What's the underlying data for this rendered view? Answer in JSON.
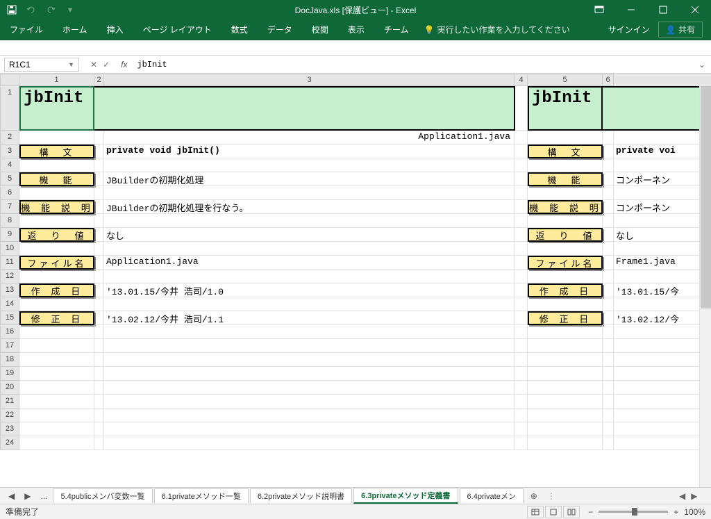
{
  "title": "DocJava.xls [保護ビュー] - Excel",
  "qat": {
    "save": "save",
    "undo": "undo",
    "redo": "redo"
  },
  "ribbon": {
    "tabs": [
      "ファイル",
      "ホーム",
      "挿入",
      "ページ レイアウト",
      "数式",
      "データ",
      "校閲",
      "表示",
      "チーム"
    ],
    "tellme": "実行したい作業を入力してください",
    "signin": "サインイン",
    "share": "共有"
  },
  "namebox": "R1C1",
  "formula": "jbInit",
  "columns": [
    "1",
    "2",
    "3",
    "4",
    "5",
    "6"
  ],
  "rows_vis": [
    "1",
    "2",
    "3",
    "4",
    "5",
    "6",
    "7",
    "8",
    "9",
    "10",
    "11",
    "12",
    "13",
    "14",
    "15",
    "16",
    "17",
    "18",
    "19",
    "20",
    "21",
    "22",
    "23",
    "24"
  ],
  "sheet": {
    "left": {
      "title": "jbInit",
      "file_right": "Application1.java",
      "rows": [
        {
          "label": "構　文",
          "value": "private void jbInit()"
        },
        {
          "label": "機　能",
          "value": "JBuilderの初期化処理"
        },
        {
          "label": "機 能 説 明",
          "value": "JBuilderの初期化処理を行なう。"
        },
        {
          "label": "返　り　値",
          "value": "なし"
        },
        {
          "label": "ファイル名",
          "value": "Application1.java"
        },
        {
          "label": "作 成 日",
          "value": "'13.01.15/今井 浩司/1.0"
        },
        {
          "label": "修 正 日",
          "value": "'13.02.12/今井 浩司/1.1"
        }
      ]
    },
    "right": {
      "title": "jbInit",
      "rows": [
        {
          "label": "構　文",
          "value": "private voi"
        },
        {
          "label": "機　能",
          "value": "コンポーネン"
        },
        {
          "label": "機 能 説 明",
          "value": "コンポーネン"
        },
        {
          "label": "返　り　値",
          "value": "なし"
        },
        {
          "label": "ファイル名",
          "value": "Frame1.java"
        },
        {
          "label": "作 成 日",
          "value": "'13.01.15/今"
        },
        {
          "label": "修 正 日",
          "value": "'13.02.12/今"
        }
      ]
    }
  },
  "tabs": {
    "items": [
      "5.4publicメンバ変数一覧",
      "6.1privateメソッド一覧",
      "6.2privateメソッド説明書",
      "6.3privateメソッド定義書",
      "6.4privateメン"
    ],
    "active": 3,
    "ellipsis": "..."
  },
  "status": {
    "ready": "準備完了",
    "zoom": "100%"
  }
}
